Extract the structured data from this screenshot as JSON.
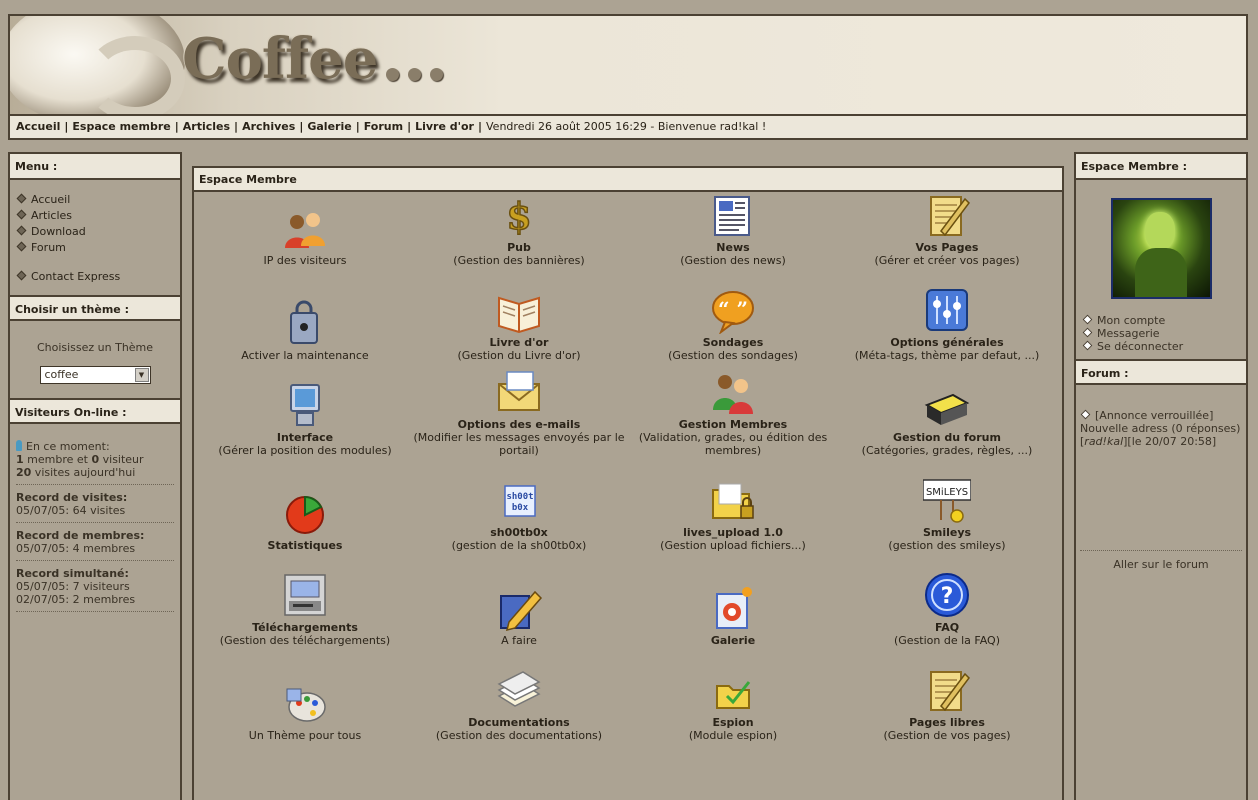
{
  "header": {
    "logo_text": "Coffee",
    "nav": [
      "Accueil",
      "Espace membre",
      "Articles",
      "Archives",
      "Galerie",
      "Forum",
      "Livre d'or"
    ],
    "status": "Vendredi 26 août 2005 16:29 -  Bienvenue rad!kal !"
  },
  "left": {
    "menu_title": "Menu :",
    "menu_items": [
      "Accueil",
      "Articles",
      "Download",
      "Forum",
      "Contact Express"
    ],
    "theme_title": "Choisir un thème :",
    "theme_label": "Choisissez un Thème",
    "theme_value": "coffee",
    "visitors_title": "Visiteurs On-line :",
    "online": {
      "now_label": "En ce moment:",
      "members_count": "1",
      "members_text": " membre et ",
      "visitors_count": "0",
      "visitors_text": " visiteur",
      "visits_count": "20",
      "visits_text": " visites aujourd'hui"
    },
    "records": [
      {
        "title": "Record de visites:",
        "lines": [
          "05/07/05: 64 visites"
        ]
      },
      {
        "title": "Record de membres:",
        "lines": [
          "05/07/05: 4 membres"
        ]
      },
      {
        "title": "Record simultané:",
        "lines": [
          "05/07/05: 7 visiteurs",
          "02/07/05: 2 membres"
        ]
      }
    ]
  },
  "center": {
    "title": "Espace Membre",
    "items": [
      {
        "name": "",
        "desc": "IP des visiteurs",
        "icon": "users-icon"
      },
      {
        "name": "Pub",
        "desc": "(Gestion des bannières)",
        "icon": "dollar-icon"
      },
      {
        "name": "News",
        "desc": "(Gestion des news)",
        "icon": "newspaper-icon"
      },
      {
        "name": "Vos Pages",
        "desc": "(Gérer et créer vos pages)",
        "icon": "notepad-icon"
      },
      {
        "name": "",
        "desc": "Activer la maintenance",
        "icon": "lock-icon"
      },
      {
        "name": "Livre d'or",
        "desc": "(Gestion du Livre d'or)",
        "icon": "book-icon"
      },
      {
        "name": "Sondages",
        "desc": "(Gestion des sondages)",
        "icon": "speech-bubble-icon"
      },
      {
        "name": "Options générales",
        "desc": "(Méta-tags, thème par defaut, ...)",
        "icon": "sliders-icon"
      },
      {
        "name": "Interface",
        "desc": "(Gérer la position des modules)",
        "icon": "monitor-icon"
      },
      {
        "name": "Options des e-mails",
        "desc": "(Modifier les messages envoyés par le portail)",
        "icon": "envelope-icon"
      },
      {
        "name": "Gestion Membres",
        "desc": "(Validation, grades, ou édition des membres)",
        "icon": "members-icon"
      },
      {
        "name": "Gestion du forum",
        "desc": "(Catégories, grades, règles, ...)",
        "icon": "forum-book-icon"
      },
      {
        "name": "Statistiques",
        "desc": "",
        "icon": "pie-chart-icon"
      },
      {
        "name": "sh00tb0x",
        "desc": "(gestion de la sh00tb0x)",
        "icon": "shoutbox-icon",
        "badge": [
          "sh00t",
          "b0x"
        ]
      },
      {
        "name": "lives_upload 1.0",
        "desc": "(Gestion upload fichiers...)",
        "icon": "folder-lock-icon"
      },
      {
        "name": "Smileys",
        "desc": "(gestion des smileys)",
        "icon": "smileys-sign-icon",
        "badge": [
          "SMiLEYS"
        ]
      },
      {
        "name": "Téléchargements",
        "desc": "(Gestion des téléchargements)",
        "icon": "download-machine-icon"
      },
      {
        "name": "",
        "desc": "A faire",
        "icon": "pencil-notebook-icon"
      },
      {
        "name": "Galerie",
        "desc": "",
        "icon": "gallery-icon"
      },
      {
        "name": "FAQ",
        "desc": "(Gestion de la FAQ)",
        "icon": "help-icon"
      },
      {
        "name": "",
        "desc": "Un Thème pour tous",
        "icon": "palette-icon"
      },
      {
        "name": "Documentations",
        "desc": "(Gestion des documentations)",
        "icon": "documents-icon"
      },
      {
        "name": "Espion",
        "desc": "(Module espion)",
        "icon": "spy-folder-icon"
      },
      {
        "name": "Pages libres",
        "desc": "(Gestion de vos pages)",
        "icon": "notepad-icon"
      }
    ]
  },
  "right": {
    "member_title": "Espace Membre :",
    "account_links": [
      "Mon compte",
      "Messagerie",
      "Se déconnecter"
    ],
    "forum_title": "Forum :",
    "forum_post_title": "[Annonce verrouillée]",
    "forum_post_text": "Nouvelle adress (0 réponses)",
    "forum_post_author": "rad!kal",
    "forum_post_date": "[le 20/07 20:58]",
    "forum_link": "Aller sur le forum"
  }
}
